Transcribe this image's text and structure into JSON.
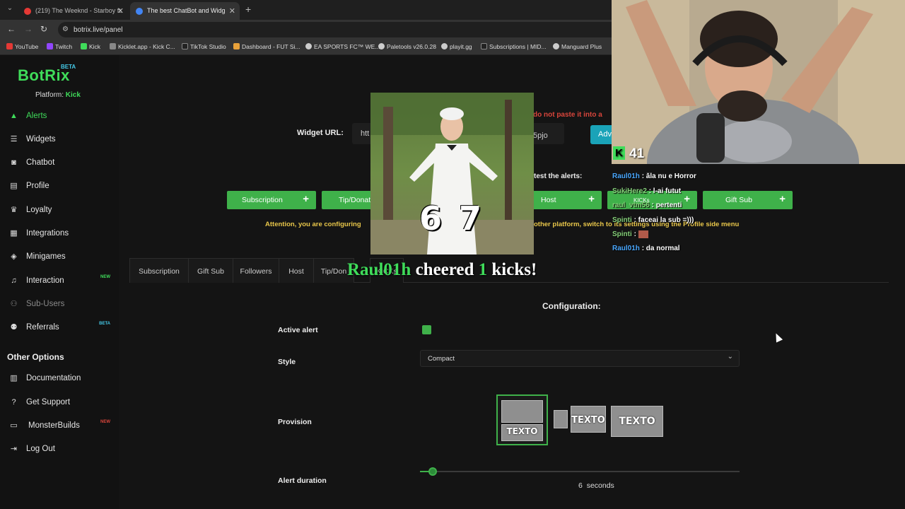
{
  "browser": {
    "tabs": [
      {
        "title": "(219) The Weeknd - Starboy ft.",
        "favicon_color": "#e53935"
      },
      {
        "title": "The best ChatBot and Widg",
        "favicon_color": "#4285f4"
      }
    ],
    "url": "botrix.live/panel",
    "bookmarks": [
      {
        "label": "YouTube",
        "color": "#e53935"
      },
      {
        "label": "Twitch",
        "color": "#9146ff"
      },
      {
        "label": "Kick",
        "color": "#3fdc5a"
      },
      {
        "label": "Kicklet.app - Kick C...",
        "color": "#888888"
      },
      {
        "label": "TikTok Studio",
        "color": "#222222"
      },
      {
        "label": "Dashboard - FUT Si...",
        "color": "#e8a13a"
      },
      {
        "label": "EA SPORTS FC™ WE...",
        "color": "#cccccc"
      },
      {
        "label": "Paletools v26.0.28",
        "color": "#cccccc"
      },
      {
        "label": "playit.gg",
        "color": "#cccccc"
      },
      {
        "label": "Subscriptions | MID...",
        "color": "#222222"
      },
      {
        "label": "Manguard Plus",
        "color": "#cccccc"
      }
    ]
  },
  "brand": {
    "name": "BotRix",
    "beta": "BETA",
    "platform_label": "Platform:",
    "platform": "Kick",
    "accent": "#3fdc5a"
  },
  "sidebar": {
    "items": [
      {
        "label": "Alerts",
        "icon": "warning-icon",
        "active": true
      },
      {
        "label": "Widgets",
        "icon": "list-icon"
      },
      {
        "label": "Chatbot",
        "icon": "robot-icon"
      },
      {
        "label": "Profile",
        "icon": "id-card-icon"
      },
      {
        "label": "Loyalty",
        "icon": "trophy-icon"
      },
      {
        "label": "Integrations",
        "icon": "integrations-icon"
      },
      {
        "label": "Minigames",
        "icon": "gamepad-icon"
      },
      {
        "label": "Interaction",
        "icon": "music-icon",
        "badge": "NEW"
      },
      {
        "label": "Sub-Users",
        "icon": "users-icon",
        "muted": true
      },
      {
        "label": "Referrals",
        "icon": "referrals-icon",
        "badge": "BETA"
      }
    ],
    "other_options_title": "Other Options",
    "other_items": [
      {
        "label": "Documentation",
        "icon": "book-icon"
      },
      {
        "label": "Get Support",
        "icon": "help-icon"
      },
      {
        "label": "MonsterBuilds",
        "icon": "laptop-icon",
        "badge": "NEW"
      },
      {
        "label": "Log Out",
        "icon": "logout-icon"
      }
    ]
  },
  "widget": {
    "label": "Widget URL:",
    "url_start": "htt",
    "url_end": "5pjo",
    "advanced_label": "Advanced",
    "warning": "do not paste it into a"
  },
  "test": {
    "label": "test the alerts:",
    "buttons": [
      "Subscription",
      "Tip/Donation",
      "Host",
      "KICKs",
      "Gift Sub"
    ]
  },
  "attention": {
    "start": "Attention, you are configuring",
    "end": "other platform, switch to its settings using the Profile side menu"
  },
  "alert_tabs": [
    "Subscription",
    "Gift Sub",
    "Followers",
    "Host",
    "Tip/Don",
    "KICKs"
  ],
  "config": {
    "title": "Configuration:",
    "active_alert_label": "Active alert",
    "active_alert": true,
    "style_label": "Style",
    "style_value": "Compact",
    "provision_label": "Provision",
    "provision_text": "TEXTO",
    "duration_label": "Alert duration",
    "duration_value": "6",
    "duration_unit": "seconds",
    "duration_fraction": 0.04
  },
  "overlay": {
    "video_caption": "6 7",
    "cheer_user": "Raul01h",
    "cheer_middle": "cheered",
    "cheer_amount": "1",
    "cheer_end": "kicks!",
    "kick_count": "41",
    "chat": [
      {
        "user": "Raul01h",
        "msg": ": ăla nu e Horror"
      },
      {
        "user": "SukiHere2",
        "msg": ": l-ai futut"
      },
      {
        "user": "raul_vtm56",
        "msg": ": pertenti"
      },
      {
        "user": "Spinti",
        "msg": ": faceai la sub =)))"
      },
      {
        "user": "Spinti",
        "msg": ":"
      },
      {
        "user": "Raul01h",
        "msg": ": da normal"
      }
    ]
  }
}
